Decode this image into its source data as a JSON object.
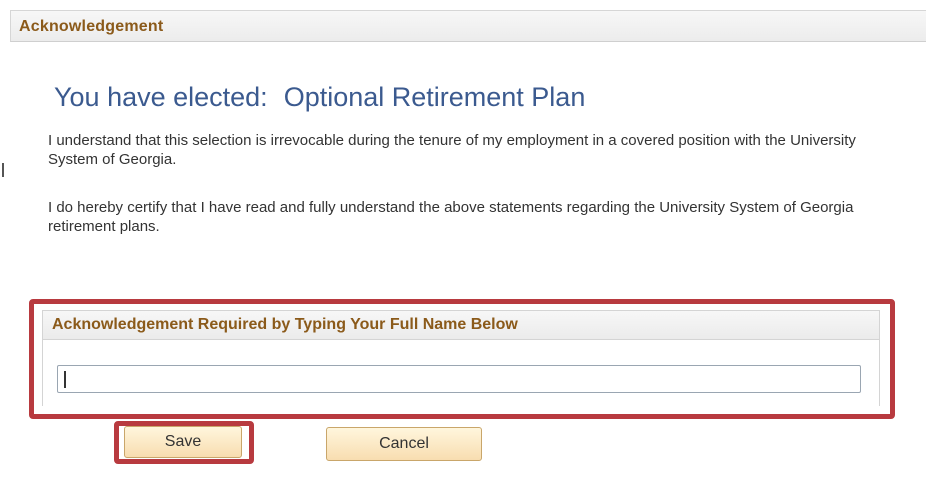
{
  "section": {
    "title": "Acknowledgement"
  },
  "election": {
    "prefix": "You have elected:",
    "plan_name": "Optional Retirement Plan"
  },
  "statements": [
    "I understand that this selection is irrevocable during the tenure of my employment in a covered position with the University System of Georgia.",
    "I do hereby certify that I have read and fully understand the above statements regarding the University System of Georgia retirement plans."
  ],
  "acknowledgement_box": {
    "title": "Acknowledgement Required by Typing Your Full Name Below",
    "input_value": "",
    "input_placeholder": ""
  },
  "buttons": {
    "save_label": "Save",
    "cancel_label": "Cancel"
  },
  "colors": {
    "header_text": "#8b5a1a",
    "elected_text": "#3b5a8f",
    "highlight_border": "#b83a3f",
    "button_fill": "#f8ddb0"
  }
}
